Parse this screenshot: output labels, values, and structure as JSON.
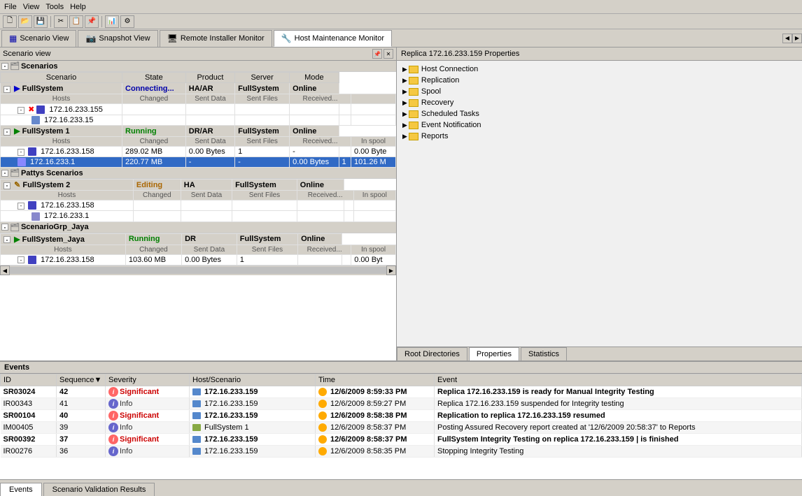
{
  "toolbar": {
    "tabs": [
      {
        "label": "Scenario View",
        "active": true,
        "icon": "scenario"
      },
      {
        "label": "Snapshot View",
        "active": false,
        "icon": "snapshot"
      },
      {
        "label": "Remote Installer Monitor",
        "active": false,
        "icon": "remote"
      },
      {
        "label": "Host Maintenance Monitor",
        "active": false,
        "icon": "host"
      }
    ]
  },
  "scenario_view": {
    "title": "Scenario view",
    "groups": [
      {
        "name": "Scenarios",
        "expanded": true,
        "scenarios": [
          {
            "name": "FullSystem",
            "state": "Connecting...",
            "product": "HA/AR",
            "server": "FullSystem",
            "mode": "Online",
            "hosts": [
              {
                "ip": "172.16.233.155",
                "changed": "",
                "sent_data": "",
                "sent_files": "",
                "received1": "",
                "received2": "",
                "in_spool": "",
                "error": true
              },
              {
                "ip": "172.16.233.15",
                "changed": "",
                "sent_data": "",
                "sent_files": "",
                "received1": "",
                "received2": "",
                "in_spool": "",
                "selected": false
              }
            ]
          },
          {
            "name": "FullSystem 1",
            "state": "Running",
            "product": "DR/AR",
            "server": "FullSystem",
            "mode": "Online",
            "hosts": [
              {
                "ip": "172.16.233.158",
                "changed": "289.02 MB",
                "sent_data": "0.00 Bytes",
                "sent_files": "1",
                "received1": "-",
                "received2": "",
                "in_spool": "0.00 Byte"
              },
              {
                "ip": "172.16.233.1",
                "changed": "220.77 MB",
                "sent_data": "-",
                "sent_files": "-",
                "received1": "0.00 Bytes",
                "received2": "1",
                "in_spool": "101.26 M",
                "selected": true
              }
            ]
          }
        ]
      },
      {
        "name": "Pattys Scenarios",
        "expanded": true,
        "scenarios": [
          {
            "name": "FullSystem 2",
            "state": "Editing",
            "product": "HA",
            "server": "FullSystem",
            "mode": "Online",
            "hosts": [
              {
                "ip": "172.16.233.158",
                "changed": "",
                "sent_data": "",
                "sent_files": "",
                "received1": "",
                "received2": "",
                "in_spool": ""
              },
              {
                "ip": "172.16.233.1",
                "changed": "",
                "sent_data": "",
                "sent_files": "",
                "received1": "",
                "received2": "",
                "in_spool": ""
              }
            ]
          }
        ]
      },
      {
        "name": "ScenarioGrp_Jaya",
        "expanded": true,
        "scenarios": [
          {
            "name": "FullSystem_Jaya",
            "state": "Running",
            "product": "DR",
            "server": "FullSystem",
            "mode": "Online",
            "hosts": [
              {
                "ip": "172.16.233.158",
                "changed": "103.60 MB",
                "sent_data": "0.00 Bytes",
                "sent_files": "1",
                "received1": "",
                "received2": "",
                "in_spool": "0.00 Byt"
              }
            ]
          }
        ]
      }
    ],
    "col_headers": [
      "Scenario",
      "State",
      "Product",
      "Server",
      "Mode"
    ],
    "host_headers": [
      "Hosts",
      "Changed",
      "Sent Data",
      "Sent Files",
      "Received...",
      "Received...",
      "In spool"
    ]
  },
  "properties": {
    "header": "Replica 172.16.233.159   Properties",
    "items": [
      {
        "label": "Host Connection"
      },
      {
        "label": "Replication"
      },
      {
        "label": "Spool"
      },
      {
        "label": "Recovery"
      },
      {
        "label": "Scheduled Tasks"
      },
      {
        "label": "Event Notification"
      },
      {
        "label": "Reports"
      }
    ],
    "tabs": [
      {
        "label": "Root Directories",
        "active": false
      },
      {
        "label": "Properties",
        "active": true
      },
      {
        "label": "Statistics",
        "active": false
      }
    ]
  },
  "events": {
    "title": "Events",
    "columns": [
      "ID",
      "Sequence",
      "Severity",
      "Host/Scenario",
      "Time",
      "Event"
    ],
    "rows": [
      {
        "id": "SR03024",
        "seq": "42",
        "severity": "Significant",
        "host": "172.16.233.159",
        "time": "12/6/2009 8:59:33 PM",
        "event": "Replica  172.16.233.159  is ready for Manual Integrity Testing",
        "type": "significant"
      },
      {
        "id": "IR00343",
        "seq": "41",
        "severity": "Info",
        "host": "172.16.233.159",
        "time": "12/6/2009 8:59:27 PM",
        "event": "Replica  172.16.233.159  suspended for Integrity testing",
        "type": "info"
      },
      {
        "id": "SR00104",
        "seq": "40",
        "severity": "Significant",
        "host": "172.16.233.159",
        "time": "12/6/2009 8:58:38 PM",
        "event": "Replication to replica 172.16.233.159  resumed",
        "type": "significant"
      },
      {
        "id": "IM00405",
        "seq": "39",
        "severity": "Info",
        "host": "FullSystem 1",
        "time": "12/6/2009 8:58:37 PM",
        "event": "Posting Assured Recovery report created at '12/6/2009 20:58:37' to Reports",
        "type": "info"
      },
      {
        "id": "SR00392",
        "seq": "37",
        "severity": "Significant",
        "host": "172.16.233.159",
        "time": "12/6/2009 8:58:37 PM",
        "event": "FullSystem Integrity Testing on replica 172.16.233.159 | is finished",
        "type": "significant"
      },
      {
        "id": "IR00276",
        "seq": "36",
        "severity": "Info",
        "host": "172.16.233.159",
        "time": "12/6/2009 8:58:35 PM",
        "event": "Stopping  Integrity Testing",
        "type": "info"
      }
    ]
  },
  "bottom_tabs": [
    {
      "label": "Events",
      "active": true
    },
    {
      "label": "Scenario Validation Results",
      "active": false
    }
  ]
}
